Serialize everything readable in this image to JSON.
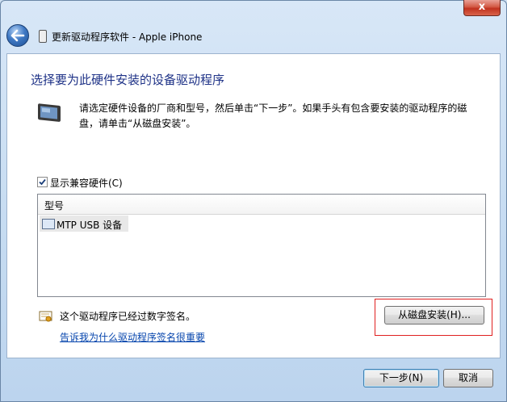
{
  "window": {
    "close_glyph": "x",
    "title": "更新驱动程序软件 - Apple iPhone"
  },
  "page": {
    "heading": "选择要为此硬件安装的设备驱动程序",
    "description": "请选定硬件设备的厂商和型号，然后单击“下一步”。如果手头有包含要安装的驱动程序的磁盘，请单击“从磁盘安装”。",
    "show_compatible_label": "显示兼容硬件(C)",
    "show_compatible_checked": true
  },
  "model_list": {
    "header": "型号",
    "items": [
      {
        "label": "MTP USB 设备",
        "icon": "device-icon"
      }
    ]
  },
  "signature": {
    "status_text": "这个驱动程序已经过数字签名。",
    "link_text": "告诉我为什么驱动程序签名很重要",
    "icon": "certificate-icon"
  },
  "buttons": {
    "have_disk": "从磁盘安装(H)...",
    "next": "下一步(N)",
    "cancel": "取消"
  },
  "colors": {
    "heading": "#1e3287",
    "link": "#0645ad",
    "highlight_box": "#e02020"
  }
}
